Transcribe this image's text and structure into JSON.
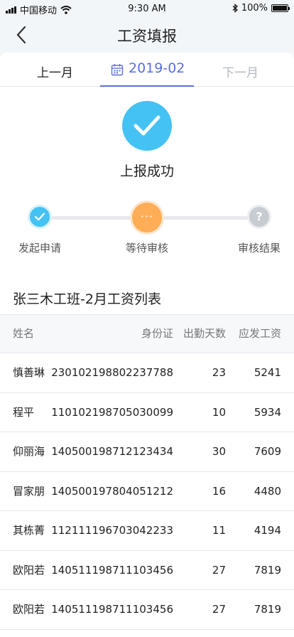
{
  "status_bar": {
    "carrier": "中国移动",
    "time": "9:30 AM",
    "battery": "100%",
    "battery_level": 1.0
  },
  "nav": {
    "title": "工资填报"
  },
  "month_selector": {
    "prev": "上一月",
    "current": "2019-02",
    "next": "下一月"
  },
  "result": {
    "text": "上报成功",
    "steps": [
      {
        "label": "发起申请",
        "state": "done"
      },
      {
        "label": "等待审核",
        "state": "current",
        "symbol": "···"
      },
      {
        "label": "审核结果",
        "state": "pending",
        "symbol": "?"
      }
    ]
  },
  "wage_list": {
    "title": "张三木工班-2月工资列表",
    "columns": {
      "name": "姓名",
      "id": "身份证",
      "days": "出勤天数",
      "pay": "应发工资"
    },
    "rows": [
      {
        "name": "慎善琳",
        "id": "230102198802237788",
        "days": "23",
        "pay": "5241"
      },
      {
        "name": "程平",
        "id": "110102198705030099",
        "days": "10",
        "pay": "5934"
      },
      {
        "name": "仰丽海",
        "id": "140500198712123434",
        "days": "30",
        "pay": "7609"
      },
      {
        "name": "冒家朋",
        "id": "140500197804051212",
        "days": "16",
        "pay": "4480"
      },
      {
        "name": "其栋菁",
        "id": "112111196703042233",
        "days": "11",
        "pay": "4194"
      },
      {
        "name": "欧阳若",
        "id": "140511198711103456",
        "days": "27",
        "pay": "7819"
      },
      {
        "name": "欧阳若",
        "id": "140511198711103456",
        "days": "27",
        "pay": "7819"
      }
    ]
  },
  "colors": {
    "accent": "#5b6ee0",
    "success": "#45c2f4",
    "waiting": "#ffad57",
    "pending": "#c7ccd2"
  },
  "icons": {
    "back": "chevron-left-icon",
    "calendar": "calendar-icon",
    "success": "check-circle-icon",
    "wifi": "wifi-icon",
    "bluetooth": "bluetooth-icon"
  }
}
